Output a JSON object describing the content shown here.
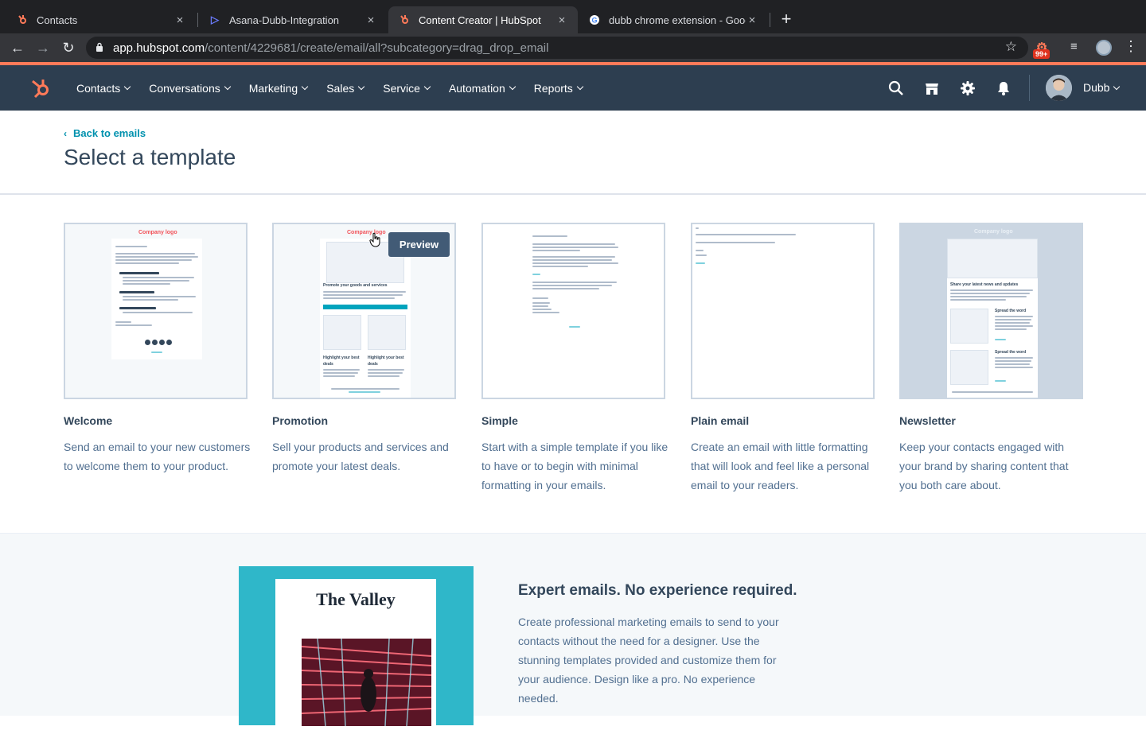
{
  "browser": {
    "tabs": [
      {
        "title": "Contacts",
        "favicon": "hubspot-icon",
        "active": false
      },
      {
        "title": "Asana-Dubb-Integration",
        "favicon": "dubb-icon",
        "active": false
      },
      {
        "title": "Content Creator | HubSpot",
        "favicon": "hubspot-icon",
        "active": true
      },
      {
        "title": "dubb chrome extension - Goog",
        "favicon": "google-icon",
        "active": false
      }
    ],
    "url_host": "app.hubspot.com",
    "url_path": "/content/4229681/create/email/all?subcategory=drag_drop_email",
    "extension_badge": "99+"
  },
  "hubspot_nav": {
    "menu": [
      "Contacts",
      "Conversations",
      "Marketing",
      "Sales",
      "Service",
      "Automation",
      "Reports"
    ],
    "user_name": "Dubb",
    "accent_color": "#ff7a59",
    "bar_color": "#2d3e50"
  },
  "header": {
    "back_label": "Back to emails",
    "title": "Select a template"
  },
  "templates": [
    {
      "name": "Welcome",
      "description": "Send an email to your new customers to welcome them to your product.",
      "logo_text": "Company logo"
    },
    {
      "name": "Promotion",
      "description": "Sell your products and services and promote your latest deals.",
      "logo_text": "Company logo",
      "preview_label": "Preview",
      "thumb_heading": "Promote your goods and services",
      "thumb_sub_1": "Highlight your best deals",
      "thumb_sub_2": "Highlight your best deals"
    },
    {
      "name": "Simple",
      "description": "Start with a simple template if you like to have or to begin with minimal formatting in your emails."
    },
    {
      "name": "Plain email",
      "description": "Create an email with little formatting that will look and feel like a personal email to your readers."
    },
    {
      "name": "Newsletter",
      "description": "Keep your contacts engaged with your brand by sharing content that you both care about.",
      "logo_text": "Company logo",
      "thumb_heading": "Share your latest news and updates",
      "thumb_sub_1": "Spread the word",
      "thumb_sub_2": "Spread the word"
    }
  ],
  "promo": {
    "art_title": "The Valley",
    "heading": "Expert emails. No experience required.",
    "text": "Create professional marketing emails to send to your contacts without the need for a designer. Use the stunning templates provided and customize them for your audience. Design like a pro. No experience needed."
  }
}
